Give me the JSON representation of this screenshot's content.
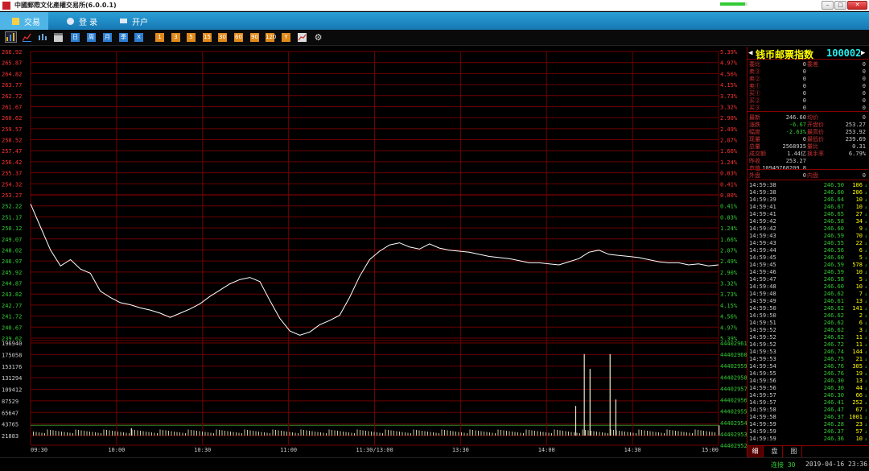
{
  "window": {
    "title": "中國郵際文化產權交易所(6.0.0.1)",
    "progress": 0.9
  },
  "nav": {
    "trade": "交易",
    "login": "登 录",
    "open_account": "开户"
  },
  "toolbar": {
    "blue_buttons": [
      "日",
      "周",
      "月",
      "季",
      "X"
    ],
    "orange_buttons": [
      "1",
      "3",
      "5",
      "15",
      "30",
      "60",
      "90",
      "120",
      "Y"
    ]
  },
  "chart": {
    "price_ticks": [
      "266.92",
      "265.87",
      "264.82",
      "263.77",
      "262.72",
      "261.67",
      "260.62",
      "259.57",
      "258.52",
      "257.47",
      "256.42",
      "255.37",
      "254.32",
      "253.27",
      "252.22",
      "251.17",
      "250.12",
      "249.07",
      "248.02",
      "246.97",
      "245.92",
      "244.87",
      "243.82",
      "242.77",
      "241.72",
      "240.67",
      "239.62"
    ],
    "pct_ticks": [
      "5.39%",
      "4.97%",
      "4.56%",
      "4.15%",
      "3.73%",
      "3.32%",
      "2.90%",
      "2.49%",
      "2.07%",
      "1.66%",
      "1.24%",
      "0.83%",
      "0.41%",
      "0.00%",
      "0.41%",
      "0.83%",
      "1.24%",
      "1.66%",
      "2.07%",
      "2.49%",
      "2.90%",
      "3.32%",
      "3.73%",
      "4.15%",
      "4.56%",
      "4.97%",
      "5.39%"
    ],
    "volume_ticks": [
      "196940",
      "175058",
      "153176",
      "131294",
      "109412",
      "87529",
      "65647",
      "43765",
      "21883"
    ],
    "volume_right_ticks": [
      "44402961",
      "44402960",
      "44402959",
      "44402958",
      "44402957",
      "44402956",
      "44402955",
      "44402954",
      "44402953",
      "44402952"
    ],
    "time_labels": [
      "09:30",
      "10:00",
      "10:30",
      "11:00",
      "11:30/13:00",
      "13:30",
      "14:00",
      "14:30",
      "15:00"
    ]
  },
  "chart_data": {
    "type": "line",
    "prev_close": 253.27,
    "ylim": [
      239.62,
      266.92
    ],
    "x_labels": [
      "09:30",
      "10:00",
      "10:30",
      "11:00",
      "11:30/13:00",
      "13:30",
      "14:00",
      "14:30",
      "15:00"
    ],
    "series": [
      {
        "values": [
          252.4,
          250.2,
          248.0,
          246.5,
          247.1,
          246.2,
          245.8,
          244.1,
          243.5,
          243.0,
          242.8,
          242.5,
          242.3,
          242.0,
          241.6,
          242.0,
          242.4,
          242.9,
          243.6,
          244.2,
          244.8,
          245.2,
          245.4,
          245.0,
          243.2,
          241.5,
          240.3,
          239.9,
          240.2,
          240.9,
          241.3,
          241.8,
          243.5,
          245.5,
          247.1,
          247.9,
          248.5,
          248.7,
          248.3,
          248.1,
          248.6,
          248.2,
          248.0,
          247.9,
          247.8,
          247.6,
          247.4,
          247.3,
          247.2,
          247.0,
          246.8,
          246.8,
          246.7,
          246.6,
          246.9,
          247.2,
          247.8,
          248.0,
          247.6,
          247.5,
          247.4,
          247.3,
          247.1,
          246.9,
          246.8,
          246.8,
          246.6,
          246.7,
          246.5,
          246.6
        ],
        "range": [
          "09:30",
          "15:00"
        ]
      }
    ],
    "volume_bars_notable": [
      {
        "time": "11:35",
        "height_fraction": 0.08
      },
      {
        "time": "14:10",
        "height_fraction": 0.32
      },
      {
        "time": "14:13",
        "height_fraction": 0.88
      },
      {
        "time": "14:15",
        "height_fraction": 0.72
      },
      {
        "time": "14:22",
        "height_fraction": 0.88
      },
      {
        "time": "14:24",
        "height_fraction": 0.39
      },
      {
        "time": "15:00",
        "height_fraction": 0.11
      }
    ],
    "volume_baseline_value": 21883,
    "ylim_volume": [
      0,
      196940
    ]
  },
  "quote": {
    "name": "钱币邮票指数",
    "code": "100002",
    "rows": [
      {
        "l1": "委比",
        "v1": "0",
        "l2": "委差",
        "v2": "0"
      },
      {
        "l1": "卖③",
        "v1": "0",
        "l2": "",
        "v2": "0"
      },
      {
        "l1": "卖②",
        "v1": "0",
        "l2": "",
        "v2": "0"
      },
      {
        "l1": "卖①",
        "v1": "0",
        "l2": "",
        "v2": "0"
      },
      {
        "l1": "买①",
        "v1": "0",
        "l2": "",
        "v2": "0"
      },
      {
        "l1": "买②",
        "v1": "0",
        "l2": "",
        "v2": "0"
      },
      {
        "l1": "买③",
        "v1": "0",
        "l2": "",
        "v2": "0"
      },
      {
        "l1": "最新",
        "v1": "246.60",
        "l2": "均价",
        "v2": "0"
      },
      {
        "l1": "涨跌",
        "v1": "-6.67",
        "l2": "开盘价",
        "v2": "253.27"
      },
      {
        "l1": "幅度",
        "v1": "-2.63%",
        "l2": "最高价",
        "v2": "253.92"
      },
      {
        "l1": "现量",
        "v1": "0",
        "l2": "最低价",
        "v2": "239.69"
      },
      {
        "l1": "总量",
        "v1": "2568935",
        "l2": "量比",
        "v2": "0.31"
      },
      {
        "l1": "成交额",
        "v1": "1.44亿",
        "l2": "换手率",
        "v2": "6.79%"
      },
      {
        "l1": "昨收",
        "v1": "253.27",
        "l2": "",
        "v2": ""
      },
      {
        "l1": "市值",
        "v1": "10949768209.8",
        "l2": "",
        "v2": ""
      },
      {
        "l1": "外盘",
        "v1": "0",
        "l2": "内盘",
        "v2": "0"
      }
    ],
    "ticks": [
      {
        "t": "14:59:38",
        "p": "246.50",
        "q": "106"
      },
      {
        "t": "14:59:38",
        "p": "246.60",
        "q": "206"
      },
      {
        "t": "14:59:39",
        "p": "246.64",
        "q": "10"
      },
      {
        "t": "14:59:41",
        "p": "246.67",
        "q": "10"
      },
      {
        "t": "14:59:41",
        "p": "246.65",
        "q": "27"
      },
      {
        "t": "14:59:42",
        "p": "246.58",
        "q": "34"
      },
      {
        "t": "14:59:42",
        "p": "246.60",
        "q": "9"
      },
      {
        "t": "14:59:43",
        "p": "246.59",
        "q": "70"
      },
      {
        "t": "14:59:43",
        "p": "246.55",
        "q": "22"
      },
      {
        "t": "14:59:44",
        "p": "246.56",
        "q": "6"
      },
      {
        "t": "14:59:45",
        "p": "246.60",
        "q": "5"
      },
      {
        "t": "14:59:45",
        "p": "246.59",
        "q": "578"
      },
      {
        "t": "14:59:46",
        "p": "246.59",
        "q": "10"
      },
      {
        "t": "14:59:47",
        "p": "246.58",
        "q": "5"
      },
      {
        "t": "14:59:48",
        "p": "246.60",
        "q": "10"
      },
      {
        "t": "14:59:48",
        "p": "246.62",
        "q": "7"
      },
      {
        "t": "14:59:49",
        "p": "246.61",
        "q": "13"
      },
      {
        "t": "14:59:50",
        "p": "246.62",
        "q": "141"
      },
      {
        "t": "14:59:50",
        "p": "246.62",
        "q": "2"
      },
      {
        "t": "14:59:51",
        "p": "246.62",
        "q": "6"
      },
      {
        "t": "14:59:52",
        "p": "246.62",
        "q": "3"
      },
      {
        "t": "14:59:52",
        "p": "246.62",
        "q": "11"
      },
      {
        "t": "14:59:52",
        "p": "246.72",
        "q": "11"
      },
      {
        "t": "14:59:53",
        "p": "246.74",
        "q": "144"
      },
      {
        "t": "14:59:53",
        "p": "246.75",
        "q": "21"
      },
      {
        "t": "14:59:54",
        "p": "246.76",
        "q": "305"
      },
      {
        "t": "14:59:55",
        "p": "246.76",
        "q": "19"
      },
      {
        "t": "14:59:56",
        "p": "246.30",
        "q": "13"
      },
      {
        "t": "14:59:56",
        "p": "246.30",
        "q": "44"
      },
      {
        "t": "14:59:57",
        "p": "246.30",
        "q": "66"
      },
      {
        "t": "14:59:57",
        "p": "246.41",
        "q": "252"
      },
      {
        "t": "14:59:58",
        "p": "246.47",
        "q": "67"
      },
      {
        "t": "14:59:58",
        "p": "246.37",
        "q": "1001"
      },
      {
        "t": "14:59:59",
        "p": "246.28",
        "q": "23"
      },
      {
        "t": "14:59:59",
        "p": "246.37",
        "q": "57"
      },
      {
        "t": "14:59:59",
        "p": "246.36",
        "q": "10"
      }
    ],
    "tabs": [
      "细",
      "盘",
      "图"
    ]
  },
  "status": {
    "connection": "连接 30",
    "datetime": "2019-04-16 23:36"
  },
  "colors": {
    "grid": "#6e0000",
    "price_line": "#ffffff",
    "up": "#ff3333",
    "down": "#33cc33",
    "accent_nav": "#1677b3"
  }
}
